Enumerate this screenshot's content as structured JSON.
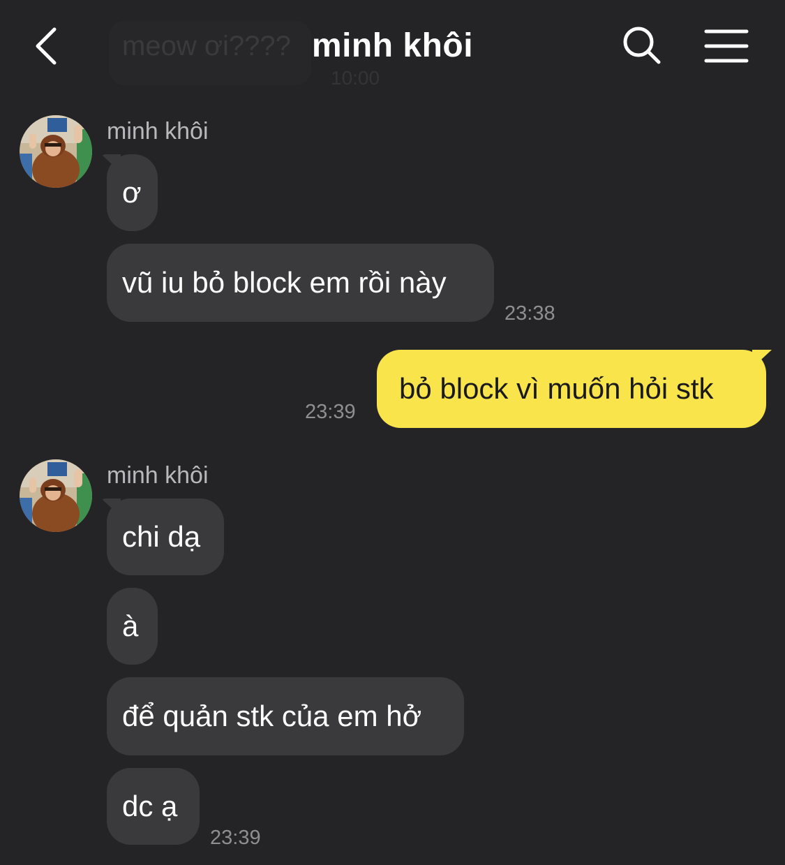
{
  "header": {
    "title": "minh khôi",
    "ghost_message": "meow ơi????",
    "ghost_time": "10:00",
    "back_icon": "chevron-left-icon",
    "search_icon": "search-icon",
    "menu_icon": "menu-icon"
  },
  "colors": {
    "background": "#242426",
    "incoming_bubble": "#3a3a3c",
    "outgoing_bubble": "#f9e54b",
    "timestamp": "#8e8e93",
    "sender_name": "#b9b9bd"
  },
  "groups": [
    {
      "sender": "minh khôi",
      "messages": [
        {
          "text": "ơ"
        },
        {
          "text": "vũ iu bỏ block em rồi này"
        }
      ],
      "time": "23:38"
    },
    {
      "sender": "me",
      "messages": [
        {
          "text": "bỏ block vì muốn hỏi stk"
        }
      ],
      "time": "23:39"
    },
    {
      "sender": "minh khôi",
      "messages": [
        {
          "text": "chi dạ"
        },
        {
          "text": "à"
        },
        {
          "text": "để quản stk của em hở"
        },
        {
          "text": "dc ạ"
        }
      ],
      "time": "23:39"
    }
  ]
}
